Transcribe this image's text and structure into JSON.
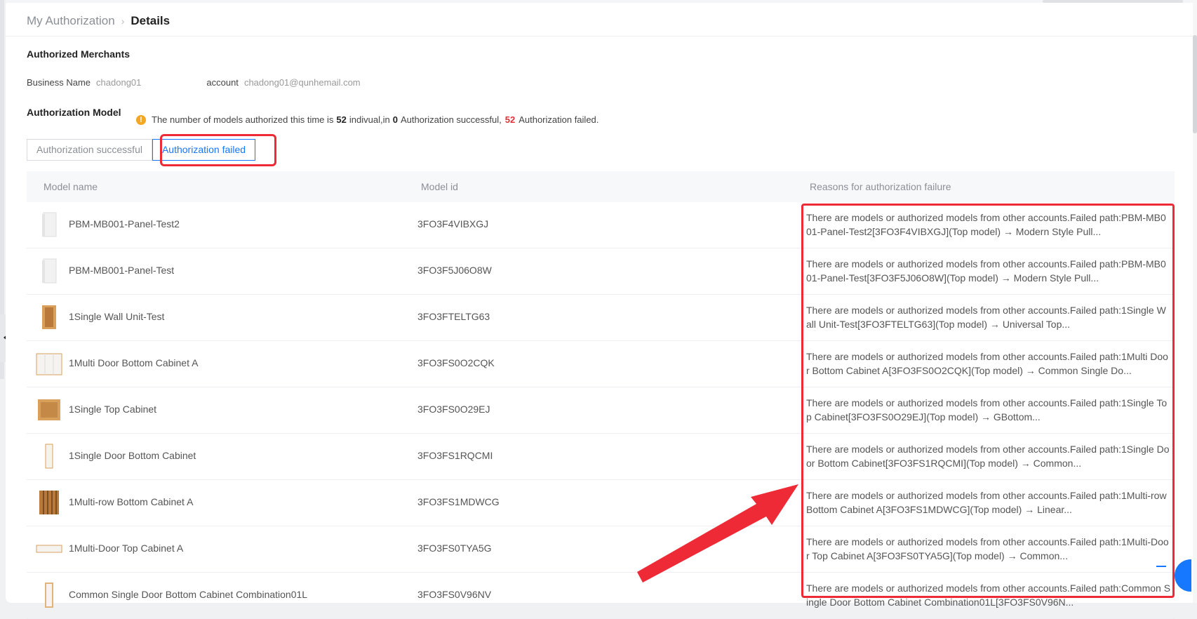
{
  "breadcrumb": {
    "parent": "My Authorization",
    "separator": "›",
    "current": "Details"
  },
  "merchants": {
    "title": "Authorized Merchants",
    "business_name_label": "Business Name",
    "business_name_value": "chadong01",
    "account_label": "account",
    "account_value": "chadong01@qunhemail.com"
  },
  "model_section": {
    "title": "Authorization Model",
    "notice_icon": "warning-icon",
    "notice_prefix": "The number of models authorized this time is",
    "total": "52",
    "notice_mid1": "indivual,in",
    "success_count": "0",
    "notice_mid2": "Authorization successful,",
    "failed_count": "52",
    "notice_suffix": "Authorization failed."
  },
  "tabs": [
    {
      "label": "Authorization successful",
      "active": false
    },
    {
      "label": "Authorization failed",
      "active": true
    }
  ],
  "table": {
    "columns": [
      "Model name",
      "Model id",
      "Reasons for authorization failure"
    ],
    "rows": [
      {
        "name": "PBM-MB001-Panel-Test2",
        "id": "3FO3F4VIBXGJ",
        "thumb": "panel-white-icon",
        "reason": "There are models or authorized models from other accounts.Failed path:PBM-MB001-Panel-Test2[3FO3F4VIBXGJ](Top model) → Modern Style Pull..."
      },
      {
        "name": "PBM-MB001-Panel-Test",
        "id": "3FO3F5J06O8W",
        "thumb": "panel-white-icon",
        "reason": "There are models or authorized models from other accounts.Failed path:PBM-MB001-Panel-Test[3FO3F5J06O8W](Top model) → Modern Style Pull..."
      },
      {
        "name": "1Single Wall Unit-Test",
        "id": "3FO3FTELTG63",
        "thumb": "wood-cabinet-icon",
        "reason": "There are models or authorized models from other accounts.Failed path:1Single Wall Unit-Test[3FO3FTELTG63](Top model) → Universal Top..."
      },
      {
        "name": "1Multi Door Bottom Cabinet A",
        "id": "3FO3FS0O2CQK",
        "thumb": "white-cabinet-icon",
        "reason": "There are models or authorized models from other accounts.Failed path:1Multi Door Bottom Cabinet A[3FO3FS0O2CQK](Top model) → Common Single Do..."
      },
      {
        "name": "1Single Top Cabinet",
        "id": "3FO3FS0O29EJ",
        "thumb": "wood-box-icon",
        "reason": "There are models or authorized models from other accounts.Failed path:1Single Top Cabinet[3FO3FS0O29EJ](Top model) → GBottom..."
      },
      {
        "name": "1Single Door Bottom Cabinet",
        "id": "3FO3FS1RQCMI",
        "thumb": "narrow-cabinet-icon",
        "reason": "There are models or authorized models from other accounts.Failed path:1Single Door Bottom Cabinet[3FO3FS1RQCMI](Top model) → Common..."
      },
      {
        "name": "1Multi-row Bottom Cabinet A",
        "id": "3FO3FS1MDWCG",
        "thumb": "shelf-cabinet-icon",
        "reason": "There are models or authorized models from other accounts.Failed path:1Multi-row Bottom Cabinet A[3FO3FS1MDWCG](Top model) → Linear..."
      },
      {
        "name": "1Multi-Door Top Cabinet A",
        "id": "3FO3FS0TYA5G",
        "thumb": "flat-cabinet-icon",
        "reason": "There are models or authorized models from other accounts.Failed path:1Multi-Door Top Cabinet A[3FO3FS0TYA5G](Top model) → Common..."
      },
      {
        "name": "Common Single Door Bottom Cabinet Combination01L",
        "id": "3FO3FS0V96NV",
        "thumb": "tall-cabinet-icon",
        "reason": "There are models or authorized models from other accounts.Failed path:Common Single Door Bottom Cabinet Combination01L[3FO3FS0V96N..."
      }
    ]
  },
  "colors": {
    "accent": "#1677ff",
    "highlight": "#ee2a37",
    "warning": "#f5a623"
  }
}
